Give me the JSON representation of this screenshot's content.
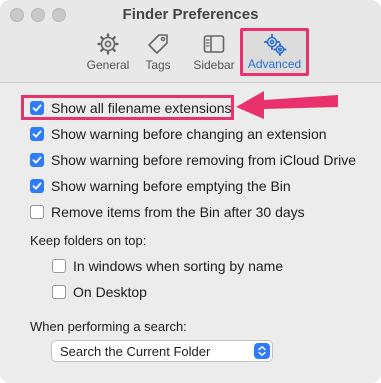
{
  "window": {
    "title": "Finder Preferences"
  },
  "tabs": [
    {
      "label": "General",
      "icon": "gear-icon",
      "selected": false
    },
    {
      "label": "Tags",
      "icon": "tag-icon",
      "selected": false
    },
    {
      "label": "Sidebar",
      "icon": "sidebar-icon",
      "selected": false
    },
    {
      "label": "Advanced",
      "icon": "gears-icon",
      "selected": true
    }
  ],
  "options": [
    {
      "label": "Show all filename extensions",
      "checked": true
    },
    {
      "label": "Show warning before changing an extension",
      "checked": true
    },
    {
      "label": "Show warning before removing from iCloud Drive",
      "checked": true
    },
    {
      "label": "Show warning before emptying the Bin",
      "checked": true
    },
    {
      "label": "Remove items from the Bin after 30 days",
      "checked": false
    }
  ],
  "folders_on_top": {
    "heading": "Keep folders on top:",
    "options": [
      {
        "label": "In windows when sorting by name",
        "checked": false
      },
      {
        "label": "On Desktop",
        "checked": false
      }
    ]
  },
  "search": {
    "heading": "When performing a search:",
    "selected": "Search the Current Folder"
  },
  "colors": {
    "accent": "#2f7cf6",
    "annotation": "#e8316d",
    "selected_tab_text": "#2a6cd4"
  }
}
